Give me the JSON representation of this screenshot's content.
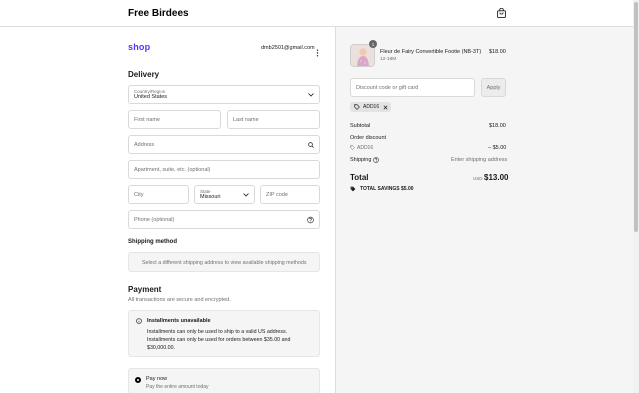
{
  "header": {
    "store_name": "Free Birdees"
  },
  "account": {
    "logo_text": "shop",
    "email": "dmb2501@gmail.com"
  },
  "delivery": {
    "title": "Delivery",
    "country": {
      "label": "Country/Region",
      "value": "United States"
    },
    "first_name_placeholder": "First name",
    "last_name_placeholder": "Last name",
    "address_placeholder": "Address",
    "apartment_placeholder": "Apartment, suite, etc. (optional)",
    "city_placeholder": "City",
    "state": {
      "label": "State",
      "value": "Missouri"
    },
    "zip_placeholder": "ZIP code",
    "phone_placeholder": "Phone (optional)"
  },
  "shipping_method": {
    "title": "Shipping method",
    "message": "Select a different shipping address to view available shipping methods"
  },
  "payment": {
    "title": "Payment",
    "subtitle": "All transactions are secure and encrypted.",
    "installments": {
      "title": "Installments unavailable",
      "line1": "Installments can only be used to ship to a valid US address.",
      "line2": "Installments can only be used for orders between $35.00 and",
      "line3": "$30,000.00."
    },
    "pay_now": {
      "title": "Pay now",
      "subtitle": "Pay the entire amount today"
    }
  },
  "summary": {
    "product": {
      "name": "Fleur de Fairy Convertible Footie (NB-3T)",
      "variant": "12-18M",
      "price": "$18.00",
      "quantity": "1"
    },
    "discount_placeholder": "Discount code or gift card",
    "apply_label": "Apply",
    "applied_code": "ADD16",
    "subtotal_label": "Subtotal",
    "subtotal_value": "$18.00",
    "order_discount_label": "Order discount",
    "order_discount_code": "ADD16",
    "order_discount_value": "– $5.00",
    "shipping_label": "Shipping",
    "shipping_value": "Enter shipping address",
    "total_label": "Total",
    "currency": "USD",
    "total_value": "$13.00",
    "savings_label": "TOTAL SAVINGS",
    "savings_value": "$5.00"
  },
  "colors": {
    "shop_brand": "#5a31f4",
    "panel_bg": "#f5f5f5",
    "border": "#d9d9d9"
  }
}
